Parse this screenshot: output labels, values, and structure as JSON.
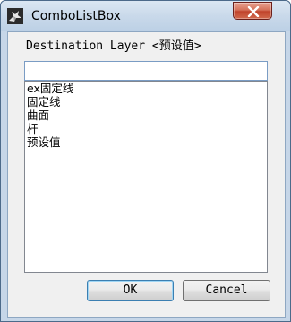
{
  "window": {
    "title": "ComboListBox",
    "close_symbol": "✕"
  },
  "icons": {
    "app": "rhino-app-icon",
    "close": "close-icon"
  },
  "form": {
    "label": "Destination Layer <预设值>",
    "input_value": "",
    "list_items": [
      "ex固定线",
      "固定线",
      "曲面",
      "杆",
      "预设值"
    ]
  },
  "buttons": {
    "ok_label": "OK",
    "cancel_label": "Cancel"
  },
  "colors": {
    "titlebar": "#c9d9ea",
    "close_button": "#c0432b",
    "default_button_border": "#3c7fb1"
  }
}
